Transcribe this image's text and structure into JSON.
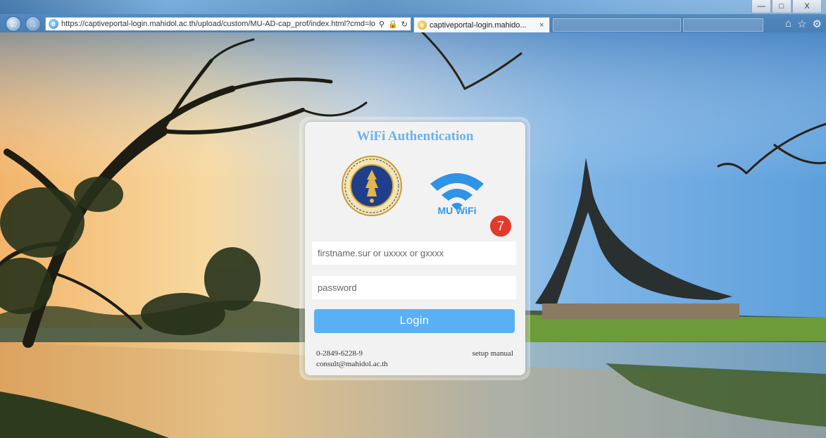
{
  "browser": {
    "address_url": "https://captiveportal-login.mahidol.ac.th/upload/custom/MU-AD-cap_prof/index.html?cmd=lo",
    "tab_title": "captiveportal-login.mahido...",
    "tab_close": "×",
    "window_buttons": {
      "minimize": "—",
      "maximize": "□",
      "close": "X"
    },
    "icons": [
      "back-icon",
      "forward-icon",
      "search-icon",
      "lock-icon",
      "refresh-icon",
      "home-icon",
      "favorites-star-icon",
      "settings-gear-icon"
    ]
  },
  "login": {
    "title": "WiFi Authentication",
    "wifi_logo_label": "MU WiFi",
    "badge_number": "7",
    "username_placeholder": "firstname.sur or uxxxx or gxxxx",
    "password_placeholder": "password",
    "login_button": "Login",
    "phone": "0-2849-6228-9",
    "email": "consult@mahidol.ac.th",
    "setup_manual": "setup manual"
  },
  "colors": {
    "title_blue": "#6ab0f0",
    "button_blue": "#5ab0f5",
    "badge_red": "#e33a2c",
    "wifi_blue": "#3598e6"
  }
}
